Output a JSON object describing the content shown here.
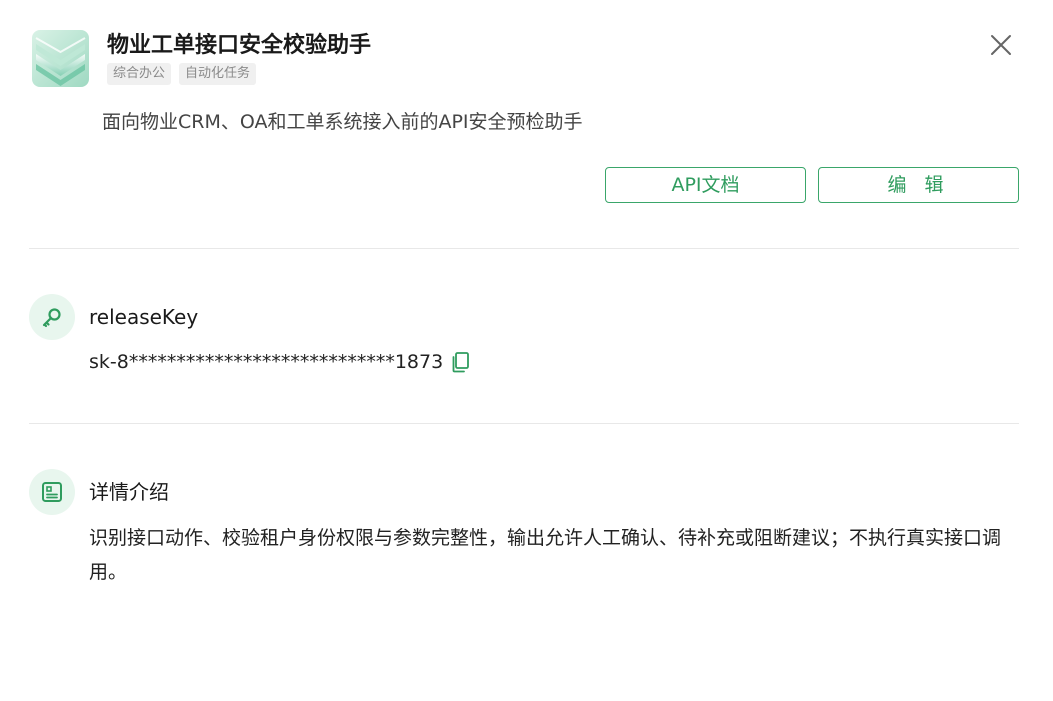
{
  "app": {
    "title": "物业工单接口安全校验助手",
    "tags": [
      "综合办公",
      "自动化任务"
    ],
    "description": "面向物业CRM、OA和工单系统接入前的API安全预检助手"
  },
  "actions": {
    "api_docs_label": "API文档",
    "edit_label": "编 辑"
  },
  "release_key": {
    "title": "releaseKey",
    "value": "sk-8****************************1873"
  },
  "detail": {
    "title": "详情介绍",
    "text": "识别接口动作、校验租户身份权限与参数完整性，输出允许人工确认、待补充或阻断建议；不执行真实接口调用。"
  },
  "icons": {
    "logo": "layered-stack-logo",
    "close": "close-icon",
    "key": "key-icon",
    "detail": "document-icon",
    "copy": "copy-icon"
  },
  "colors": {
    "accent": "#2f9c5e",
    "accent_border": "#3aa66a",
    "icon_bg": "#e8f6ee",
    "tag_bg": "#f0f0f0",
    "tag_text": "#8a8a8a"
  }
}
